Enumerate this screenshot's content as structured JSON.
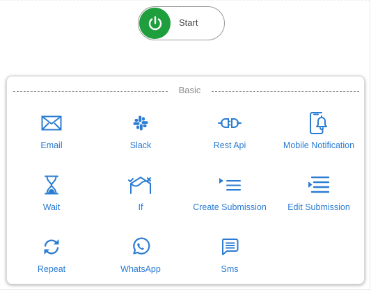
{
  "start_button": {
    "label": "Start",
    "icon": "power-icon",
    "color": "#1f9e3e"
  },
  "basic_section": {
    "title": "Basic",
    "accent_color": "#2b7cd3",
    "items": [
      {
        "label": "Email",
        "icon": "envelope-icon"
      },
      {
        "label": "Slack",
        "icon": "slack-icon"
      },
      {
        "label": "Rest Api",
        "icon": "plug-connector-icon"
      },
      {
        "label": "Mobile Notification",
        "icon": "mobile-bell-icon"
      },
      {
        "label": "Wait",
        "icon": "hourglass-icon"
      },
      {
        "label": "If",
        "icon": "branch-check-icon"
      },
      {
        "label": "Create Submission",
        "icon": "list-add-icon"
      },
      {
        "label": "Edit Submission",
        "icon": "list-edit-icon"
      },
      {
        "label": "Repeat",
        "icon": "repeat-arrows-icon"
      },
      {
        "label": "WhatsApp",
        "icon": "whatsapp-icon"
      },
      {
        "label": "Sms",
        "icon": "chat-message-icon"
      }
    ]
  }
}
